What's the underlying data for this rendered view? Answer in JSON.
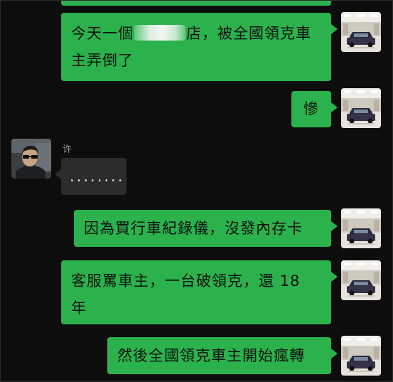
{
  "messages": [
    {
      "side": "out",
      "text_before": "今天一個",
      "text_after": "店，被全國領克車主弄倒了"
    },
    {
      "side": "out",
      "text": "慘"
    },
    {
      "side": "in",
      "sender": "许",
      "text": "........"
    },
    {
      "side": "out",
      "text": "因為買行車紀錄儀，沒發內存卡"
    },
    {
      "side": "out",
      "text": "客服罵車主，一台破領克，還 18 年"
    },
    {
      "side": "out",
      "text": "然後全國領克車主開始瘋轉"
    }
  ],
  "colors": {
    "background": "#0d0d0d",
    "outgoing_bubble": "#2bb24c",
    "incoming_bubble": "#2c2c2c",
    "sender_name": "#9a9a9a"
  },
  "icons": {
    "self_avatar": "car-photo-avatar",
    "contact_avatar": "person-photo-avatar"
  }
}
